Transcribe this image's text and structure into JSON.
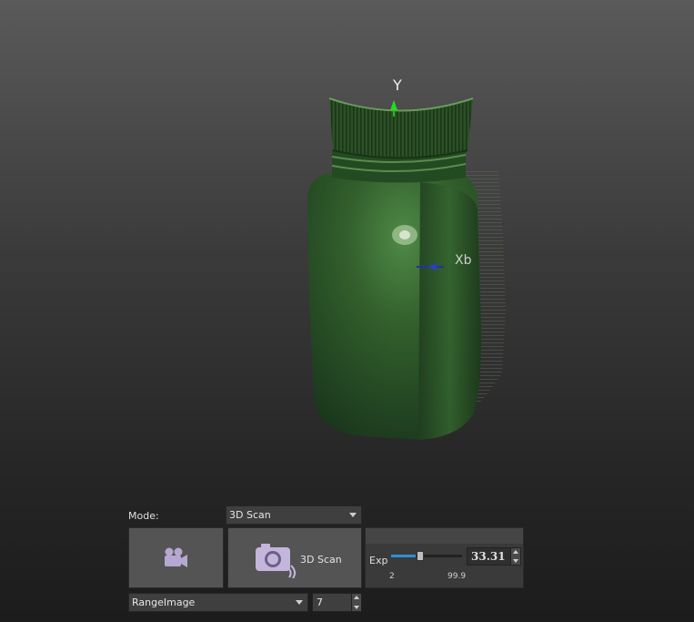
{
  "viewport": {
    "axis_y_label": "Y",
    "axis_x_label": "Xb",
    "object": "bottle-scan-mesh"
  },
  "controls": {
    "mode_label": "Mode:",
    "mode_value": "3D Scan",
    "video_button_icon": "video-camera-icon",
    "scan_button_icon": "camera-icon",
    "scan_button_label": "3D Scan",
    "range_value": "RangeImage",
    "range_count": "7"
  },
  "exposure": {
    "label": "Exp",
    "value": "33.31",
    "min": "2",
    "max": "99.9",
    "slider_fraction": 0.34
  },
  "colors": {
    "mesh_green": "#2f5a2a",
    "axis_y": "#22bb22",
    "axis_x": "#2233aa",
    "slider_fill": "#2f8fd6"
  }
}
